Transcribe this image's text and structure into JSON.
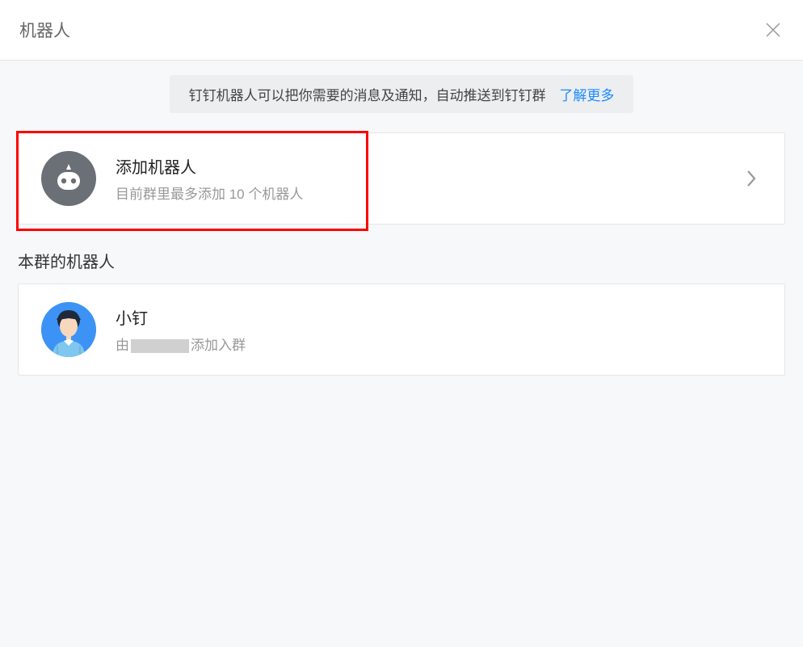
{
  "header": {
    "title": "机器人"
  },
  "banner": {
    "text": "钉钉机器人可以把你需要的消息及通知，自动推送到钉钉群",
    "link_label": "了解更多"
  },
  "add_robot": {
    "title": "添加机器人",
    "subtitle": "目前群里最多添加 10 个机器人"
  },
  "section": {
    "title": "本群的机器人"
  },
  "robots": [
    {
      "name": "小钉",
      "added_by_prefix": "由",
      "added_by_name": "",
      "added_by_suffix": "添加入群"
    }
  ]
}
